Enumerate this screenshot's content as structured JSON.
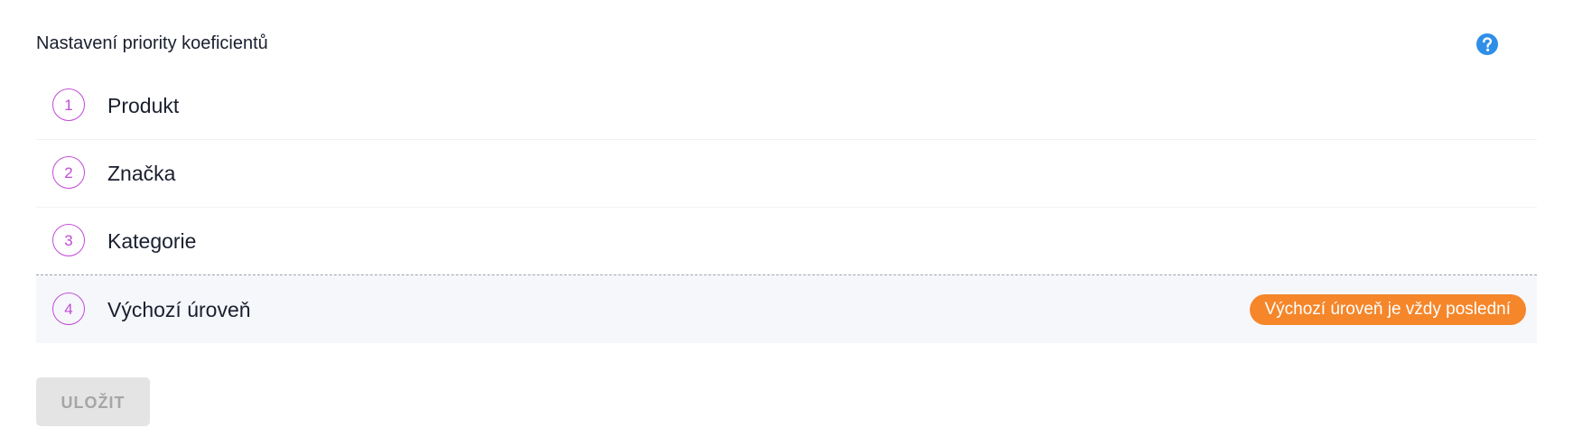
{
  "header": {
    "title": "Nastavení priority koeficientů",
    "help_icon": "question-circle-icon"
  },
  "colors": {
    "accent": "#c24bd6",
    "badge": "#f5862a",
    "help": "#2f8fe8",
    "disabled_bg": "#e4e4e4"
  },
  "priorities": [
    {
      "num": "1",
      "label": "Produkt"
    },
    {
      "num": "2",
      "label": "Značka"
    },
    {
      "num": "3",
      "label": "Kategorie"
    },
    {
      "num": "4",
      "label": "Výchozí úroveň",
      "badge": "Výchozí úroveň je vždy poslední"
    }
  ],
  "save_button": {
    "label": "ULOŽIT",
    "disabled": true
  }
}
